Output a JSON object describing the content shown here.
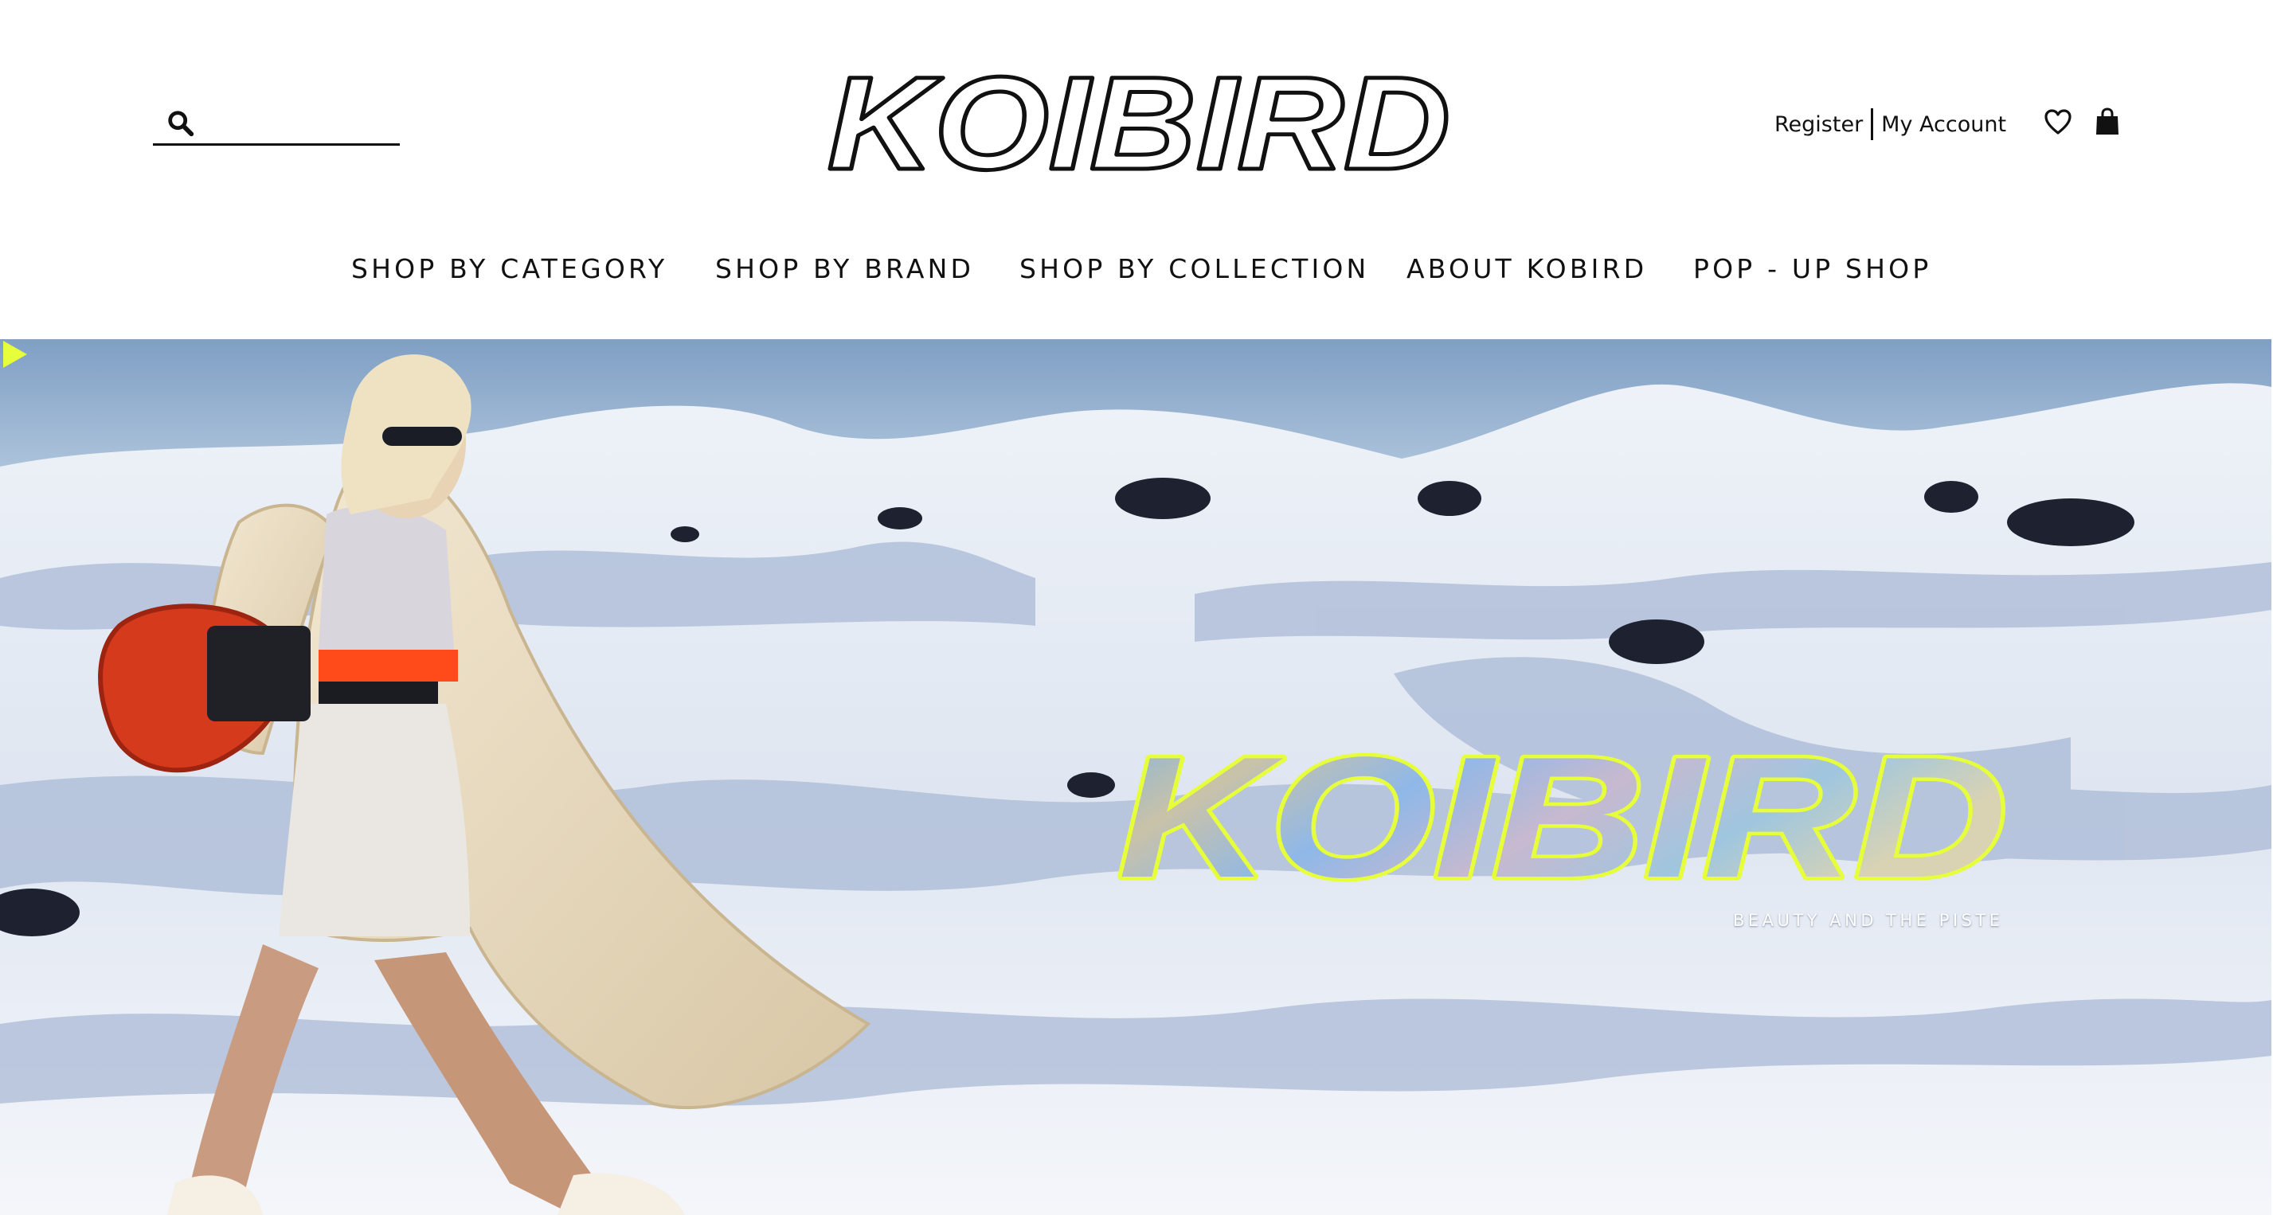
{
  "brand": {
    "logo_text": "KOIBIRD",
    "accent_color": "#e6ff3a",
    "hero_orange": "#ff4a1a"
  },
  "search": {
    "placeholder": "",
    "value": "",
    "icon": "search-icon"
  },
  "account": {
    "register_label": "Register",
    "my_account_label": "My Account"
  },
  "header_icons": {
    "wishlist": "heart-icon",
    "cart": "shopping-bag-icon"
  },
  "nav": {
    "items": [
      {
        "label": "SHOP BY CATEGORY"
      },
      {
        "label": "SHOP BY BRAND"
      },
      {
        "label": "SHOP BY COLLECTION"
      },
      {
        "label": "ABOUT KOBIRD"
      },
      {
        "label": "POP - UP SHOP"
      }
    ]
  },
  "hero": {
    "logo_text": "KOIBIRD",
    "tagline": "BEAUTY AND THE PISTE",
    "arrow_icon": "play-arrow-icon"
  }
}
